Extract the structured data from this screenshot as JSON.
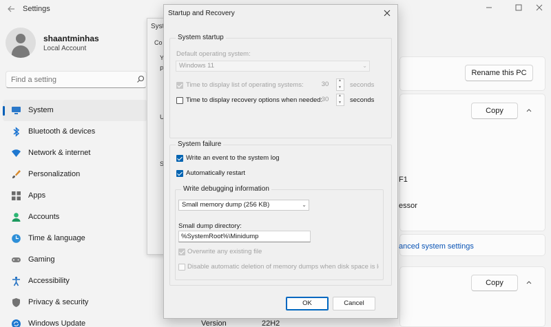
{
  "settings": {
    "app_title": "Settings",
    "user": {
      "name": "shaantminhas",
      "account": "Local Account"
    },
    "search": {
      "placeholder": "Find a setting"
    },
    "nav": [
      {
        "label": "System",
        "icon": "monitor-icon",
        "active": true
      },
      {
        "label": "Bluetooth & devices",
        "icon": "bluetooth-icon"
      },
      {
        "label": "Network & internet",
        "icon": "wifi-icon"
      },
      {
        "label": "Personalization",
        "icon": "brush-icon"
      },
      {
        "label": "Apps",
        "icon": "apps-icon"
      },
      {
        "label": "Accounts",
        "icon": "person-icon"
      },
      {
        "label": "Time & language",
        "icon": "globe-clock-icon"
      },
      {
        "label": "Gaming",
        "icon": "gamepad-icon"
      },
      {
        "label": "Accessibility",
        "icon": "accessibility-icon"
      },
      {
        "label": "Privacy & security",
        "icon": "shield-icon"
      },
      {
        "label": "Windows Update",
        "icon": "update-icon"
      }
    ],
    "content": {
      "rename_button": "Rename this PC",
      "copy_button_1": "Copy",
      "copy_button_2": "Copy",
      "fragment_f1": "F1",
      "fragment_processor": "essor",
      "advanced_link": "anced system settings",
      "version_label": "Version",
      "version_value": "22H2"
    }
  },
  "sysprops": {
    "title": "Syste",
    "frag_co": "Co",
    "frag_y": "Y",
    "frag_p": "P",
    "frag_u": "U",
    "frag_s": "S"
  },
  "dialog": {
    "title": "Startup and Recovery",
    "system_startup": {
      "group_title": "System startup",
      "default_os_label": "Default operating system:",
      "default_os_value": "Windows 11",
      "time_list_label": "Time to display list of operating systems:",
      "time_list_value": "30",
      "time_list_unit": "seconds",
      "time_list_checked": true,
      "time_recovery_label": "Time to display recovery options when needed:",
      "time_recovery_value": "30",
      "time_recovery_unit": "seconds",
      "time_recovery_checked": false
    },
    "system_failure": {
      "group_title": "System failure",
      "write_event_label": "Write an event to the system log",
      "write_event_checked": true,
      "auto_restart_label": "Automatically restart",
      "auto_restart_checked": true,
      "debug_group_title": "Write debugging information",
      "dump_type": "Small memory dump (256 KB)",
      "dump_dir_label": "Small dump directory:",
      "dump_dir_value": "%SystemRoot%\\Minidump",
      "overwrite_label": "Overwrite any existing file",
      "overwrite_checked": true,
      "disable_auto_delete_label": "Disable automatic deletion of memory dumps when disk space is lo",
      "disable_auto_delete_checked": false
    },
    "ok_label": "OK",
    "cancel_label": "Cancel"
  }
}
